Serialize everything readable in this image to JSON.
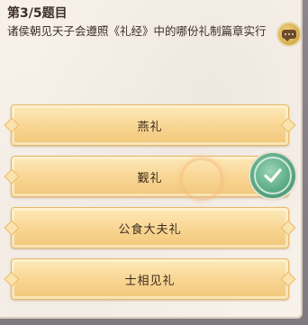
{
  "question": {
    "index_label": "第3/5题目",
    "text": "诸侯朝见天子会遵照《礼经》中的哪份礼制篇章实行"
  },
  "options": [
    {
      "label": "燕礼"
    },
    {
      "label": "觐礼",
      "correct": true
    },
    {
      "label": "公食大夫礼"
    },
    {
      "label": "士相见礼"
    }
  ],
  "icons": {
    "chat": "chat-bubble-icon",
    "correct": "checkmark-icon"
  },
  "colors": {
    "option_fill": "#f8d592",
    "correct_badge": "#5aa985"
  }
}
